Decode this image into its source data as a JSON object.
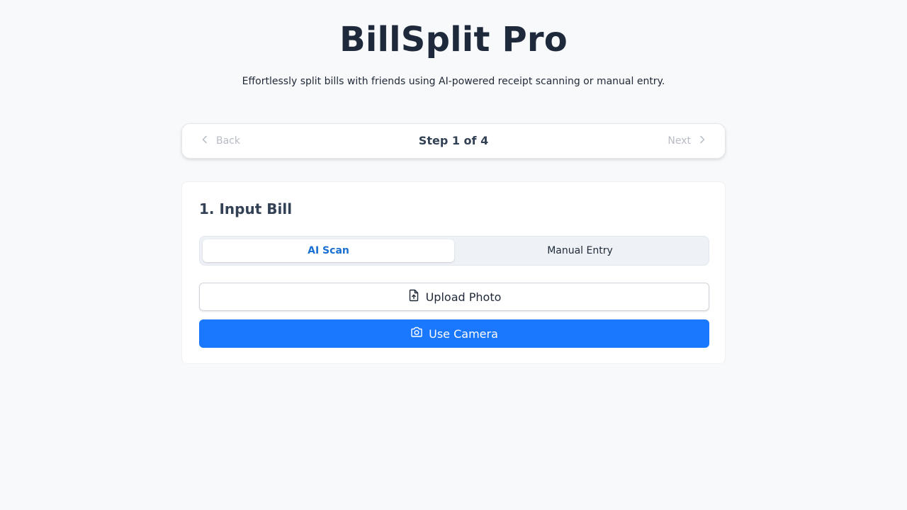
{
  "header": {
    "title": "BillSplit Pro",
    "subtitle": "Effortlessly split bills with friends using AI-powered receipt scanning or manual entry."
  },
  "stepper": {
    "back_label": "Back",
    "step_label": "Step 1 of 4",
    "next_label": "Next",
    "back_icon": "chevron-left-icon",
    "next_icon": "chevron-right-icon"
  },
  "input_card": {
    "title": "1. Input Bill",
    "tabs": [
      {
        "label": "AI Scan",
        "active": true
      },
      {
        "label": "Manual Entry",
        "active": false
      }
    ],
    "upload_button": {
      "label": "Upload Photo",
      "icon": "file-upload-icon"
    },
    "camera_button": {
      "label": "Use Camera",
      "icon": "camera-icon"
    }
  },
  "colors": {
    "accent": "#1a78ff",
    "active_tab_text": "#1a6fd0",
    "background": "#f8f9fb",
    "disabled_text": "#b6bbc4"
  }
}
